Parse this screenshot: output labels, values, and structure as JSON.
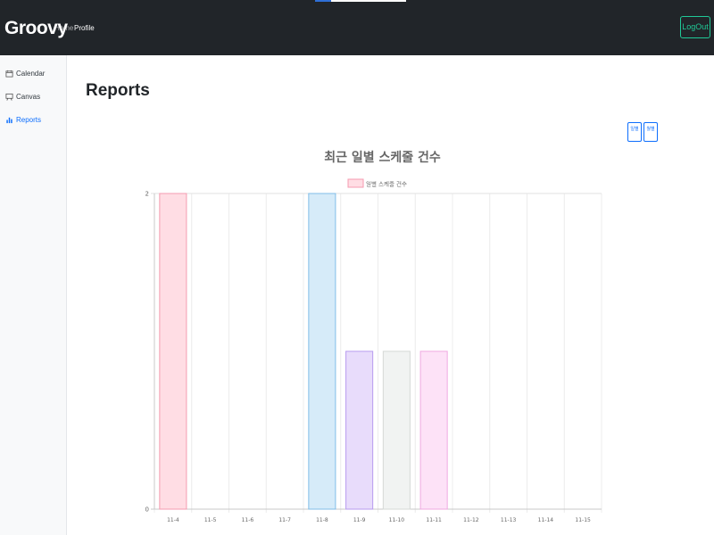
{
  "navbar": {
    "brand": "Groovy",
    "links": [
      "Home",
      "Profile"
    ],
    "logout_label": "LogOut"
  },
  "sidebar": {
    "items": [
      {
        "label": "Calendar",
        "icon": "calendar-icon"
      },
      {
        "label": "Canvas",
        "icon": "canvas-icon"
      },
      {
        "label": "Reports",
        "icon": "bar-chart-icon",
        "active": true
      }
    ]
  },
  "main": {
    "title": "Reports",
    "toggle_buttons": [
      "일별",
      "월별"
    ]
  },
  "colors": {
    "navbar_bg": "#212529",
    "logout_accent": "#20c997",
    "active_link": "#0d6efd"
  },
  "chart_data": {
    "type": "bar",
    "title": "최근 일별 스케줄 건수",
    "legend": [
      "일별 스케줄 건수"
    ],
    "legend_position": "top",
    "grid": true,
    "categories": [
      "11-4",
      "11-5",
      "11-6",
      "11-7",
      "11-8",
      "11-9",
      "11-10",
      "11-11",
      "11-12",
      "11-13",
      "11-14",
      "11-15"
    ],
    "series": [
      {
        "name": "일별 스케줄 건수",
        "values": [
          2,
          0,
          0,
          0,
          2,
          1,
          1,
          1,
          0,
          0,
          0,
          0
        ]
      }
    ],
    "ylim": [
      0,
      2
    ],
    "yticks": [
      0,
      2
    ],
    "bar_colors": [
      {
        "fill": "#ffdde4",
        "stroke": "#f59bb0"
      },
      {
        "fill": "#ffe9d3",
        "stroke": "#f8b778"
      },
      {
        "fill": "#fff3d6",
        "stroke": "#f7d27a"
      },
      {
        "fill": "#dcf5ef",
        "stroke": "#8ed6c4"
      },
      {
        "fill": "#d6ebf9",
        "stroke": "#80bde8"
      },
      {
        "fill": "#e8dcfb",
        "stroke": "#b79bef"
      },
      {
        "fill": "#f1f3f2",
        "stroke": "#d5d8d6"
      },
      {
        "fill": "#fde2f7",
        "stroke": "#f0a8e1"
      },
      {
        "fill": "#ffdde4",
        "stroke": "#f59bb0"
      },
      {
        "fill": "#ffe9d3",
        "stroke": "#f8b778"
      },
      {
        "fill": "#fff3d6",
        "stroke": "#f7d27a"
      },
      {
        "fill": "#dcf5ef",
        "stroke": "#8ed6c4"
      }
    ]
  }
}
